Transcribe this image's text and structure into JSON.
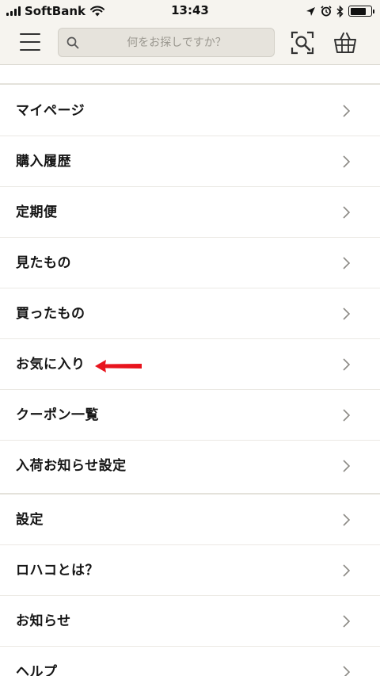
{
  "status_bar": {
    "carrier": "SoftBank",
    "time": "13:43"
  },
  "header": {
    "search_placeholder": "何をお探しですか？"
  },
  "menu_primary": [
    {
      "label": "マイページ"
    },
    {
      "label": "購入履歴"
    },
    {
      "label": "定期便"
    },
    {
      "label": "見たもの"
    },
    {
      "label": "買ったもの"
    },
    {
      "label": "お気に入り"
    },
    {
      "label": "クーポン一覧"
    },
    {
      "label": "入荷お知らせ設定"
    }
  ],
  "menu_secondary": [
    {
      "label": "設定"
    },
    {
      "label": "ロハコとは？"
    },
    {
      "label": "お知らせ"
    },
    {
      "label": "ヘルプ"
    }
  ],
  "annotation": {
    "arrow_color": "#e8141d",
    "points_to": "お気に入り"
  }
}
